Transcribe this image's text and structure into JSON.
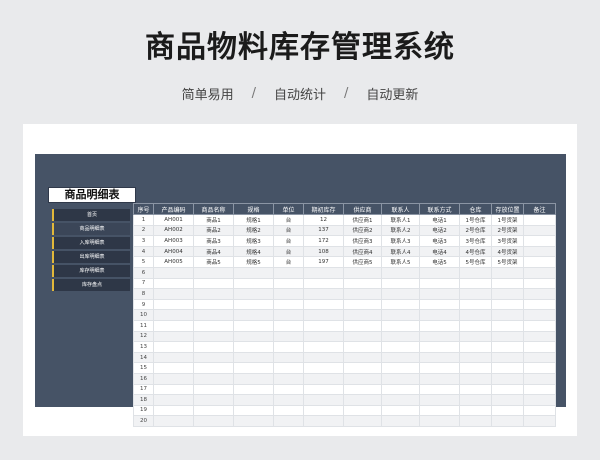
{
  "header": {
    "title": "商品物料库存管理系统",
    "tags": [
      "简单易用",
      "自动统计",
      "自动更新"
    ],
    "separator": "/"
  },
  "sheet": {
    "title": "商品明细表",
    "nav": [
      "首页",
      "商品明细表",
      "入库明细表",
      "出库明细表",
      "库存明细表",
      "库存盘点"
    ],
    "active_nav": 1,
    "columns": [
      "序号",
      "产品编码",
      "商品名称",
      "规格",
      "单位",
      "期初库存",
      "供应商",
      "联系人",
      "联系方式",
      "仓库",
      "存放位置",
      "备注"
    ],
    "rows": [
      [
        "1",
        "AH001",
        "商品1",
        "规格1",
        "台",
        "12",
        "供应商1",
        "联系人1",
        "电话1",
        "1号仓库",
        "1号货架",
        ""
      ],
      [
        "2",
        "AH002",
        "商品2",
        "规格2",
        "台",
        "137",
        "供应商2",
        "联系人2",
        "电话2",
        "2号仓库",
        "2号货架",
        ""
      ],
      [
        "3",
        "AH003",
        "商品3",
        "规格3",
        "台",
        "172",
        "供应商3",
        "联系人3",
        "电话3",
        "3号仓库",
        "3号货架",
        ""
      ],
      [
        "4",
        "AH004",
        "商品4",
        "规格4",
        "台",
        "108",
        "供应商4",
        "联系人4",
        "电话4",
        "4号仓库",
        "4号货架",
        ""
      ],
      [
        "5",
        "AH005",
        "商品5",
        "规格5",
        "台",
        "197",
        "供应商5",
        "联系人5",
        "电话5",
        "5号仓库",
        "5号货架",
        ""
      ],
      [
        "6",
        "",
        "",
        "",
        "",
        "",
        "",
        "",
        "",
        "",
        "",
        ""
      ],
      [
        "7",
        "",
        "",
        "",
        "",
        "",
        "",
        "",
        "",
        "",
        "",
        ""
      ],
      [
        "8",
        "",
        "",
        "",
        "",
        "",
        "",
        "",
        "",
        "",
        "",
        ""
      ],
      [
        "9",
        "",
        "",
        "",
        "",
        "",
        "",
        "",
        "",
        "",
        "",
        ""
      ],
      [
        "10",
        "",
        "",
        "",
        "",
        "",
        "",
        "",
        "",
        "",
        "",
        ""
      ],
      [
        "11",
        "",
        "",
        "",
        "",
        "",
        "",
        "",
        "",
        "",
        "",
        ""
      ],
      [
        "12",
        "",
        "",
        "",
        "",
        "",
        "",
        "",
        "",
        "",
        "",
        ""
      ],
      [
        "13",
        "",
        "",
        "",
        "",
        "",
        "",
        "",
        "",
        "",
        "",
        ""
      ],
      [
        "14",
        "",
        "",
        "",
        "",
        "",
        "",
        "",
        "",
        "",
        "",
        ""
      ],
      [
        "15",
        "",
        "",
        "",
        "",
        "",
        "",
        "",
        "",
        "",
        "",
        ""
      ],
      [
        "16",
        "",
        "",
        "",
        "",
        "",
        "",
        "",
        "",
        "",
        "",
        ""
      ],
      [
        "17",
        "",
        "",
        "",
        "",
        "",
        "",
        "",
        "",
        "",
        "",
        ""
      ],
      [
        "18",
        "",
        "",
        "",
        "",
        "",
        "",
        "",
        "",
        "",
        "",
        ""
      ],
      [
        "19",
        "",
        "",
        "",
        "",
        "",
        "",
        "",
        "",
        "",
        "",
        ""
      ],
      [
        "20",
        "",
        "",
        "",
        "",
        "",
        "",
        "",
        "",
        "",
        "",
        ""
      ]
    ]
  },
  "colors": {
    "panel": "#465366",
    "nav_bg": "#2e3747",
    "nav_accent": "#e2b83a"
  }
}
